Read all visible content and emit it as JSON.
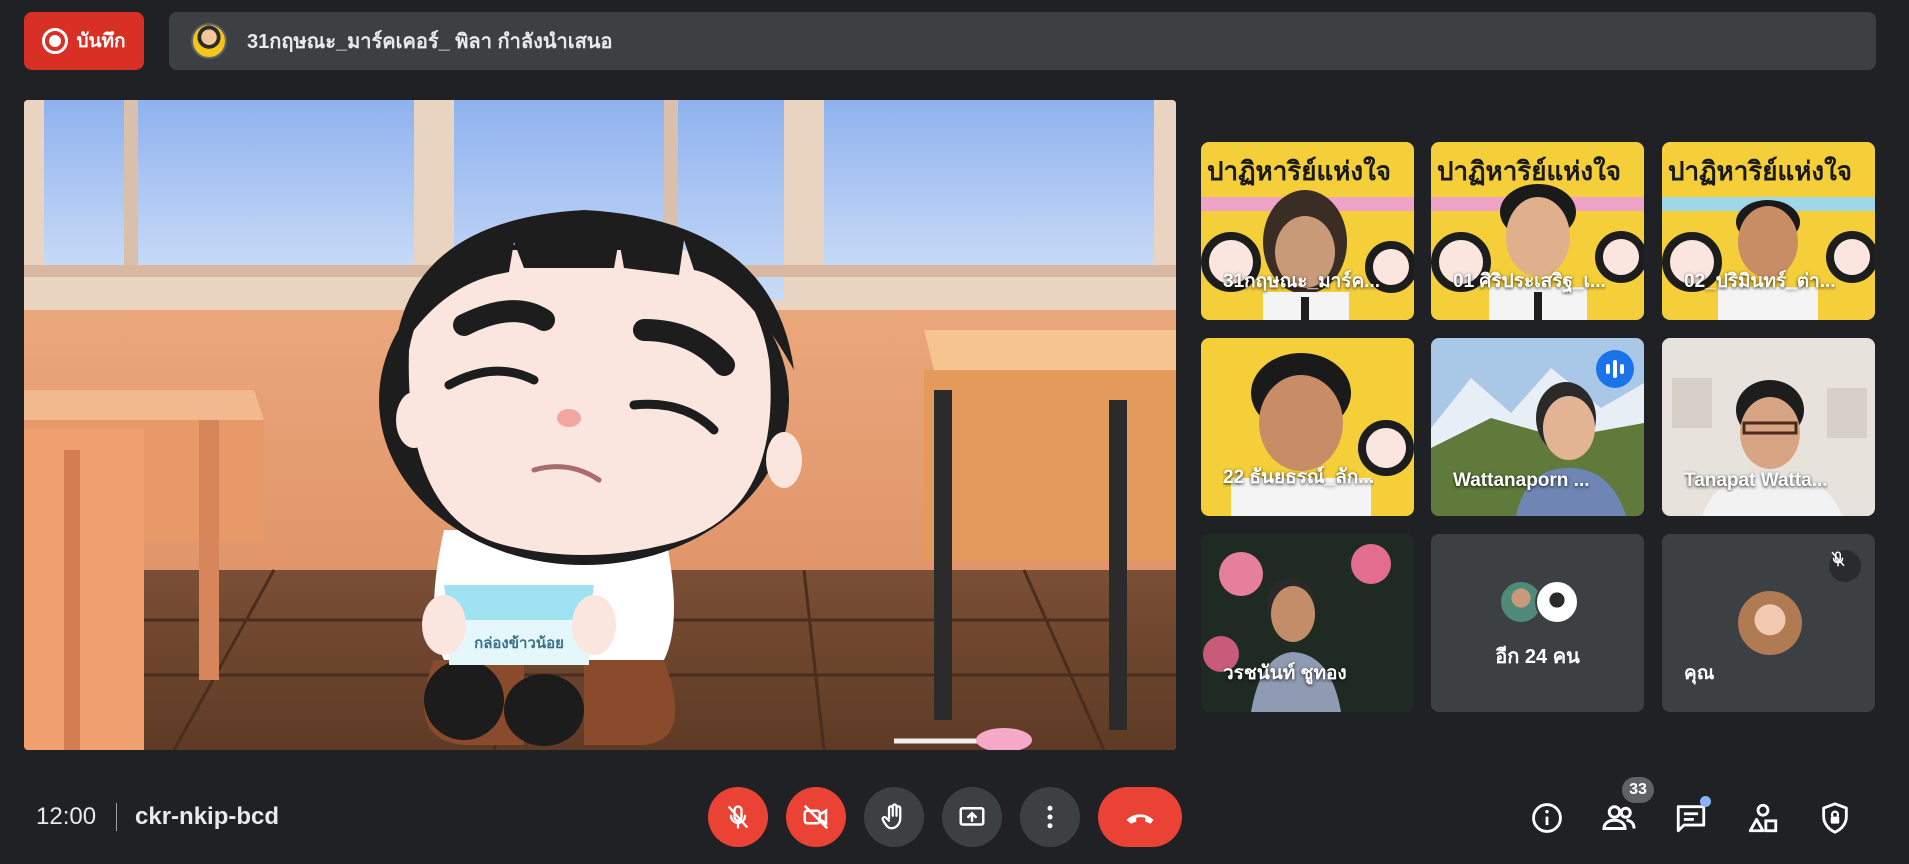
{
  "top_bar": {
    "record_label": "บันทึก",
    "presenting_text": "31กฤษณะ_มาร์คเคอร์_ พิลา กำลังนำเสนอ"
  },
  "stage": {
    "box_label": "กล่องข้าวน้อย"
  },
  "participants": [
    {
      "name": "31กฤษณะ_มาร์ค..."
    },
    {
      "name": "01 ศิริประเสริฐ_เ..."
    },
    {
      "name": "02_ปริมินทร์_ต่า..."
    },
    {
      "name": "22 ธันยธรณ์_ลัก..."
    },
    {
      "name": "Wattanaporn ..."
    },
    {
      "name": "Tanapat Watta..."
    },
    {
      "name": "วรชนันท์ ชูทอง"
    }
  ],
  "banner_text": "ปาฏิหาริย์แห่งใจ",
  "more_tile": {
    "label": "อีก 24 คน"
  },
  "self_tile": {
    "label": "คุณ"
  },
  "bottom_bar": {
    "time": "12:00",
    "meeting_code": "ckr-nkip-bcd",
    "participant_count": "33"
  },
  "colors": {
    "background": "#202124",
    "danger": "#ea4335",
    "record_red": "#d93025",
    "surface": "#3c4043",
    "accent_blue": "#1a73e8"
  },
  "icons": {
    "mic": "mic-off-icon",
    "camera": "camera-off-icon",
    "hand": "raise-hand-icon",
    "present": "present-screen-icon",
    "more": "more-options-icon",
    "hangup": "hang-up-icon",
    "info": "info-icon",
    "people": "people-icon",
    "chat": "chat-icon",
    "activities": "activities-icon",
    "host": "host-controls-icon"
  }
}
